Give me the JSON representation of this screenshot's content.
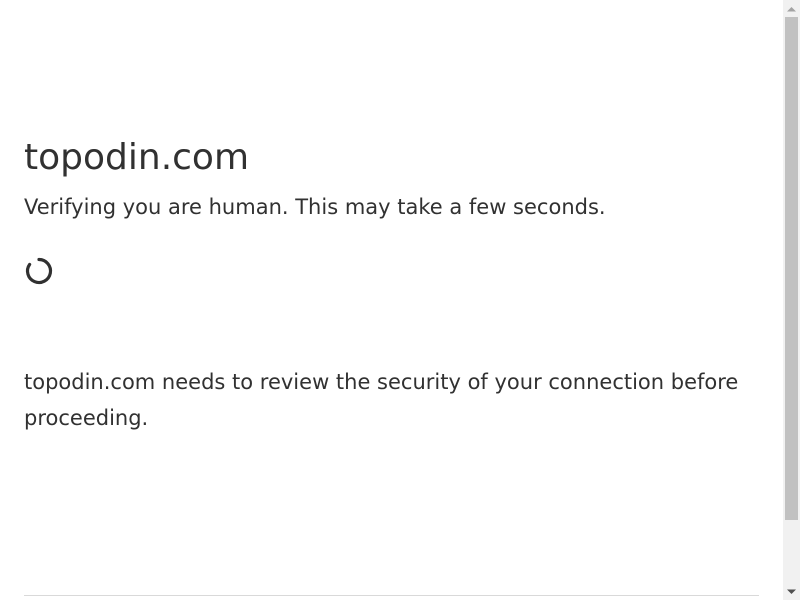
{
  "page": {
    "title": "topodin.com",
    "subtitle": "Verifying you are human. This may take a few seconds.",
    "message": "topodin.com needs to review the security of your connection before proceeding."
  },
  "icons": {
    "spinner": "loading-spinner-icon",
    "scroll_up": "chevron-up-icon",
    "scroll_down": "chevron-down-icon"
  },
  "colors": {
    "text": "#313131",
    "background": "#ffffff",
    "spinner": "#313131",
    "divider": "#d9d9d9",
    "scrollbar_track": "#f1f1f1",
    "scrollbar_thumb": "#c1c1c1"
  }
}
